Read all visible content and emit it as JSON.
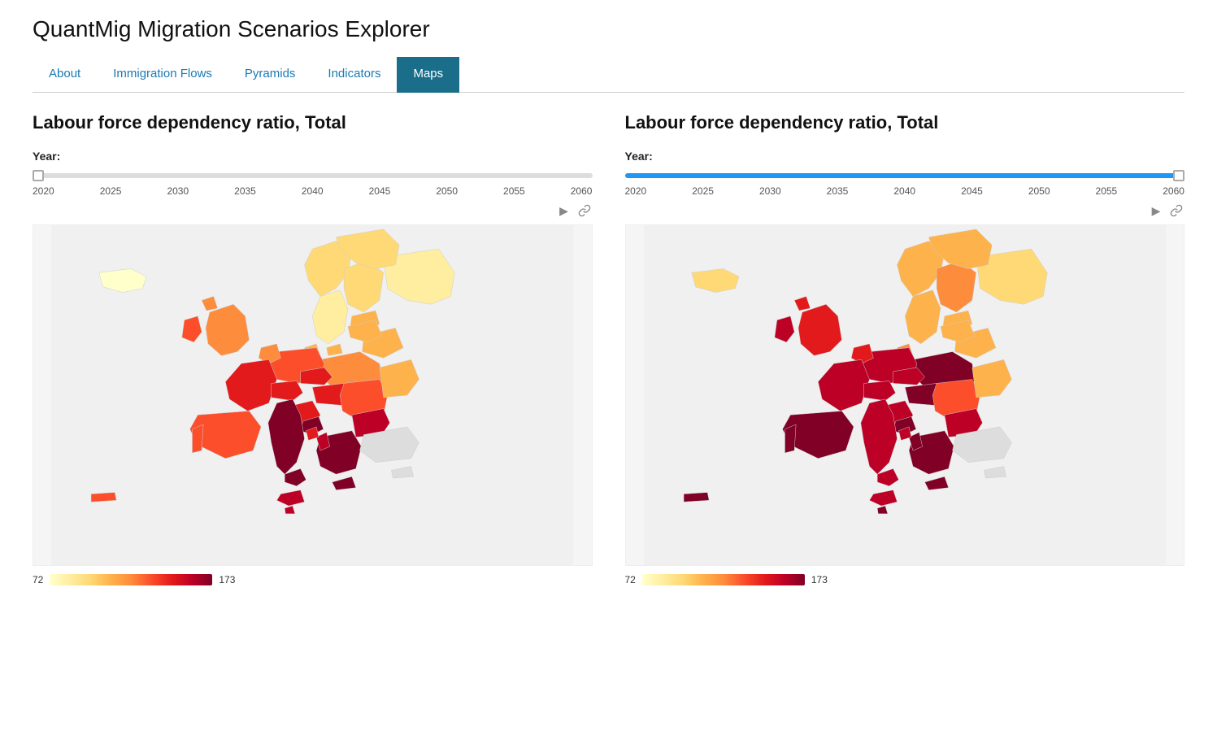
{
  "app": {
    "title": "QuantMig Migration Scenarios Explorer"
  },
  "nav": {
    "items": [
      {
        "id": "about",
        "label": "About",
        "active": false
      },
      {
        "id": "immigration-flows",
        "label": "Immigration Flows",
        "active": false
      },
      {
        "id": "pyramids",
        "label": "Pyramids",
        "active": false
      },
      {
        "id": "indicators",
        "label": "Indicators",
        "active": false
      },
      {
        "id": "maps",
        "label": "Maps",
        "active": true
      }
    ]
  },
  "maps": {
    "left": {
      "title": "Labour force dependency ratio, Total",
      "year_label": "Year:",
      "slider_value": 0,
      "slider_min": 2020,
      "slider_max": 2060,
      "year_ticks": [
        "2020",
        "2025",
        "2030",
        "2035",
        "2040",
        "2045",
        "2050",
        "2055",
        "2060"
      ],
      "play_label": "▶",
      "link_label": "⛓"
    },
    "right": {
      "title": "Labour force dependency ratio, Total",
      "year_label": "Year:",
      "slider_value": 100,
      "slider_min": 2020,
      "slider_max": 2060,
      "year_ticks": [
        "2020",
        "2025",
        "2030",
        "2035",
        "2040",
        "2045",
        "2050",
        "2055",
        "2060"
      ],
      "play_label": "▶",
      "link_label": "⛓"
    },
    "legend": {
      "min": "72",
      "max": "173"
    }
  }
}
